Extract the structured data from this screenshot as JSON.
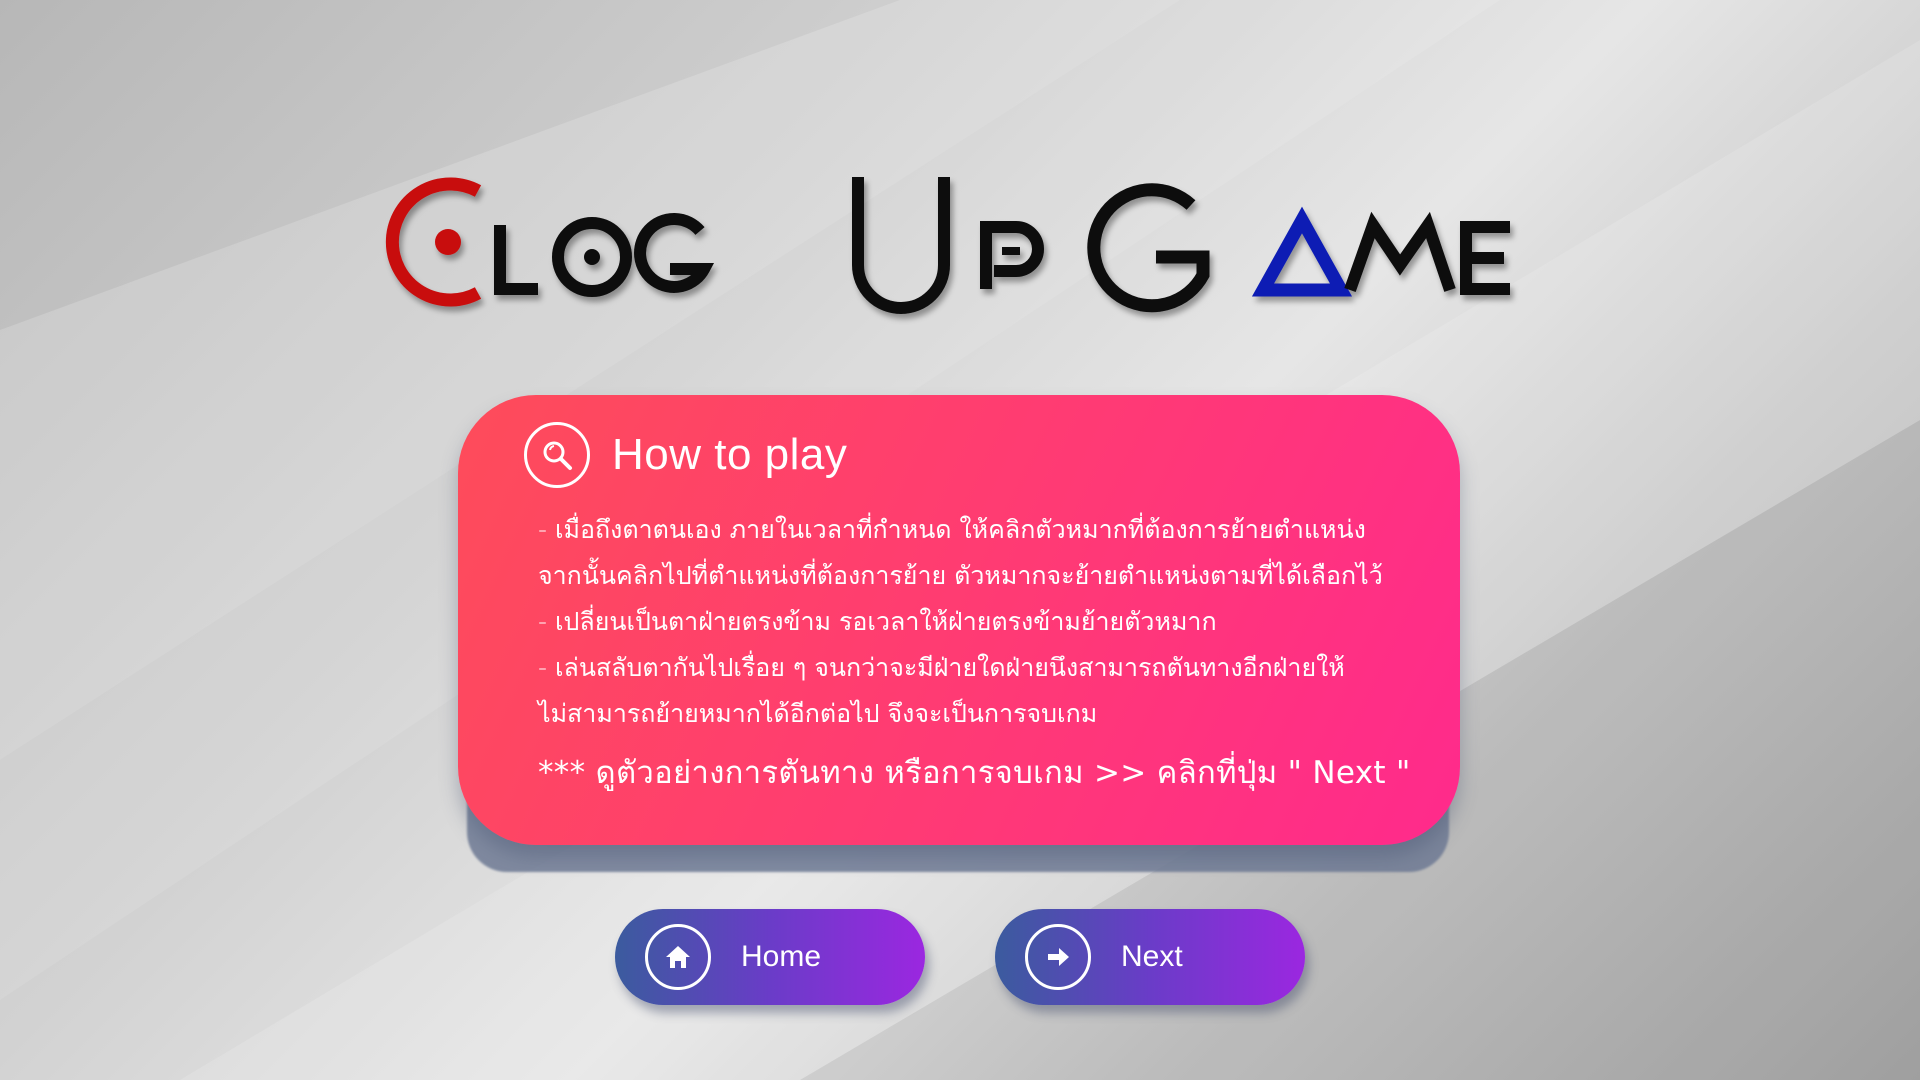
{
  "logo": {
    "text": "Clog Up Game",
    "colors": {
      "primary": "#0a0a0a",
      "accent_red": "#c80a0a",
      "accent_blue": "#0a1eb4"
    }
  },
  "card": {
    "title": "How to play",
    "icon": "search-icon",
    "rules": [
      "- เมื่อถึงตาตนเอง ภายในเวลาที่กำหนด ให้คลิกตัวหมากที่ต้องการย้ายตำแหน่ง",
      "จากนั้นคลิกไปที่ตำแหน่งที่ต้องการย้าย ตัวหมากจะย้ายตำแหน่งตามที่ได้เลือกไว้",
      "- เปลี่ยนเป็นตาฝ่ายตรงข้าม รอเวลาให้ฝ่ายตรงข้ามย้ายตัวหมาก",
      "- เล่นสลับตากันไปเรื่อย ๆ  จนกว่าจะมีฝ่ายใดฝ่ายนึงสามารถตันทางอีกฝ่ายให้",
      "ไม่สามารถย้ายหมากได้อีกต่อไป จึงจะเป็นการจบเกม"
    ],
    "note": "*** ดูตัวอย่างการตันทาง หรือการจบเกม >> คลิกที่ปุ่ม \" Next \"",
    "colors": {
      "gradient_start": "#fe4c5a",
      "gradient_end": "#ff2a8c"
    }
  },
  "buttons": {
    "home": {
      "label": "Home",
      "icon": "home-icon"
    },
    "next": {
      "label": "Next",
      "icon": "arrow-right-icon"
    },
    "colors": {
      "gradient_start": "#3b5b9e",
      "gradient_end": "#9b27e0"
    }
  }
}
